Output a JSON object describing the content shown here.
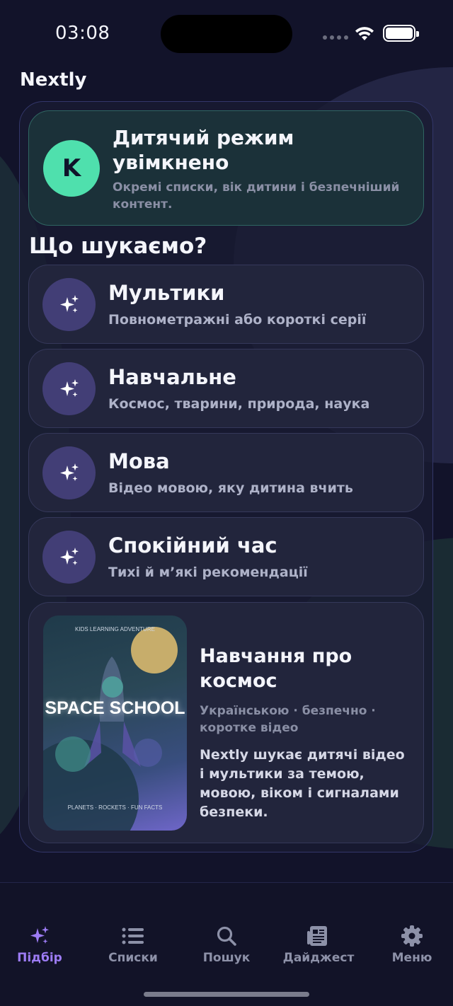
{
  "status_bar": {
    "time": "03:08"
  },
  "app": {
    "name": "Nextly"
  },
  "kids_mode": {
    "avatar_letter": "K",
    "title": "Дитячий режим увімкнено",
    "subtitle": "Окремі списки, вік дитини і безпечніший контент."
  },
  "section_title": "Що шукаємо?",
  "categories": [
    {
      "title": "Мультики",
      "subtitle": "Повнометражні або короткі серії",
      "icon": "sparkles-icon"
    },
    {
      "title": "Навчальне",
      "subtitle": "Космос, тварини, природа, наука",
      "icon": "sparkles-icon"
    },
    {
      "title": "Мова",
      "subtitle": "Відео мовою, яку дитина вчить",
      "icon": "sparkles-icon"
    },
    {
      "title": "Спокійний час",
      "subtitle": "Тихі й м’які рекомендації",
      "icon": "sparkles-icon"
    }
  ],
  "feature": {
    "poster": {
      "top_text": "KIDS LEARNING ADVENTURE",
      "title": "SPACE SCHOOL",
      "bottom_text": "PLANETS · ROCKETS · FUN FACTS"
    },
    "title": "Навчання про космос",
    "meta": "Українською · безпечно · коротке відео",
    "description": "Nextly шукає дитячі відео і мультики за темою, мовою, віком і сигналами безпеки."
  },
  "tabs": [
    {
      "label": "Підбір",
      "icon": "sparkles-icon",
      "active": true
    },
    {
      "label": "Списки",
      "icon": "list-icon",
      "active": false
    },
    {
      "label": "Пошук",
      "icon": "search-icon",
      "active": false
    },
    {
      "label": "Дайджест",
      "icon": "newspaper-icon",
      "active": false
    },
    {
      "label": "Меню",
      "icon": "gear-icon",
      "active": false
    }
  ],
  "colors": {
    "background": "#12132a",
    "accent": "#9d7cf5",
    "kids_avatar": "#4fe0ad",
    "category_icon_bg": "#423e76"
  }
}
